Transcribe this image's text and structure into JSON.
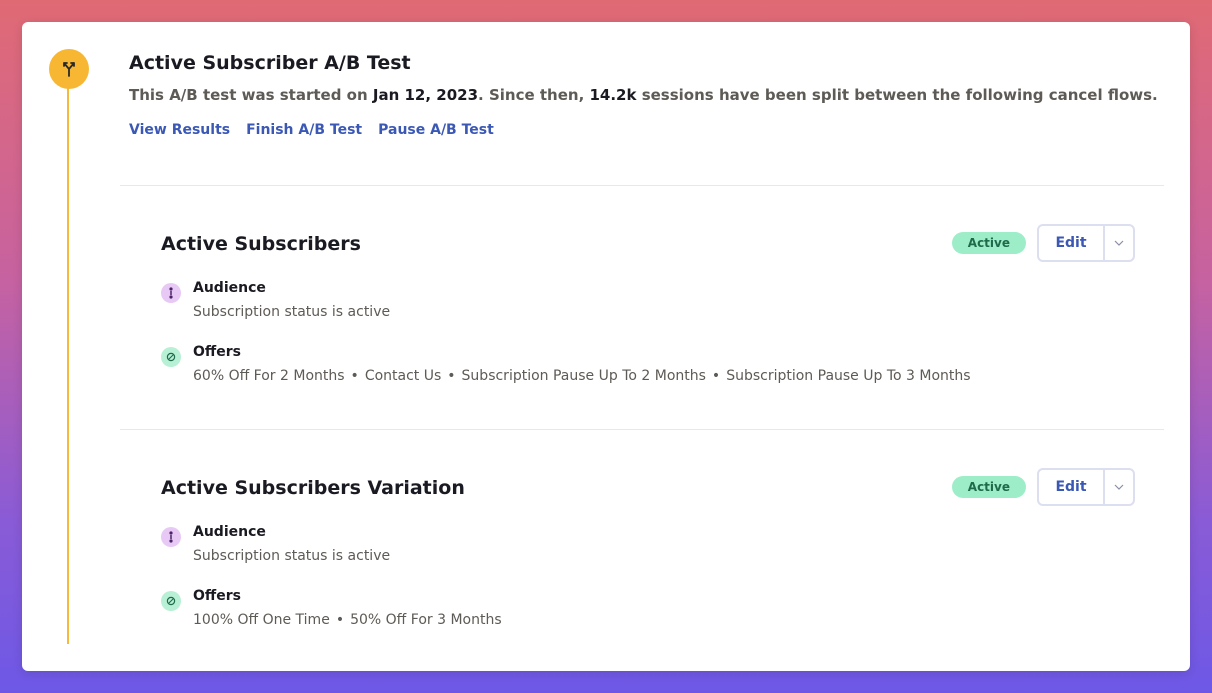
{
  "header": {
    "title": "Active Subscriber A/B Test",
    "subtitle_prefix": "This A/B test was started on ",
    "start_date": "Jan 12, 2023",
    "subtitle_mid": ". Since then, ",
    "sessions": "14.2k",
    "subtitle_suffix": " sessions have been split between the following cancel flows.",
    "links": [
      "View Results",
      "Finish A/B Test",
      "Pause A/B Test"
    ]
  },
  "flows": [
    {
      "title": "Active Subscribers",
      "status": "Active",
      "edit_label": "Edit",
      "audience_label": "Audience",
      "audience_text": "Subscription status is active",
      "offers_label": "Offers",
      "offers": [
        "60% Off For 2 Months",
        "Contact Us",
        "Subscription Pause Up To 2 Months",
        "Subscription Pause Up To 3 Months"
      ]
    },
    {
      "title": "Active Subscribers Variation",
      "status": "Active",
      "edit_label": "Edit",
      "audience_label": "Audience",
      "audience_text": "Subscription status is active",
      "offers_label": "Offers",
      "offers": [
        "100% Off One Time",
        "50% Off For 3 Months"
      ]
    }
  ],
  "colors": {
    "accent": "#f7b733",
    "link": "#3b58b5",
    "badge_bg": "#9deec8",
    "audience_icon_bg": "#e8c9f5",
    "offers_icon_bg": "#b7f0d4"
  },
  "icons": {
    "timeline": "split-arrows-icon",
    "audience": "audience-icon",
    "offers": "offers-icon",
    "dropdown": "chevron-down-icon"
  }
}
